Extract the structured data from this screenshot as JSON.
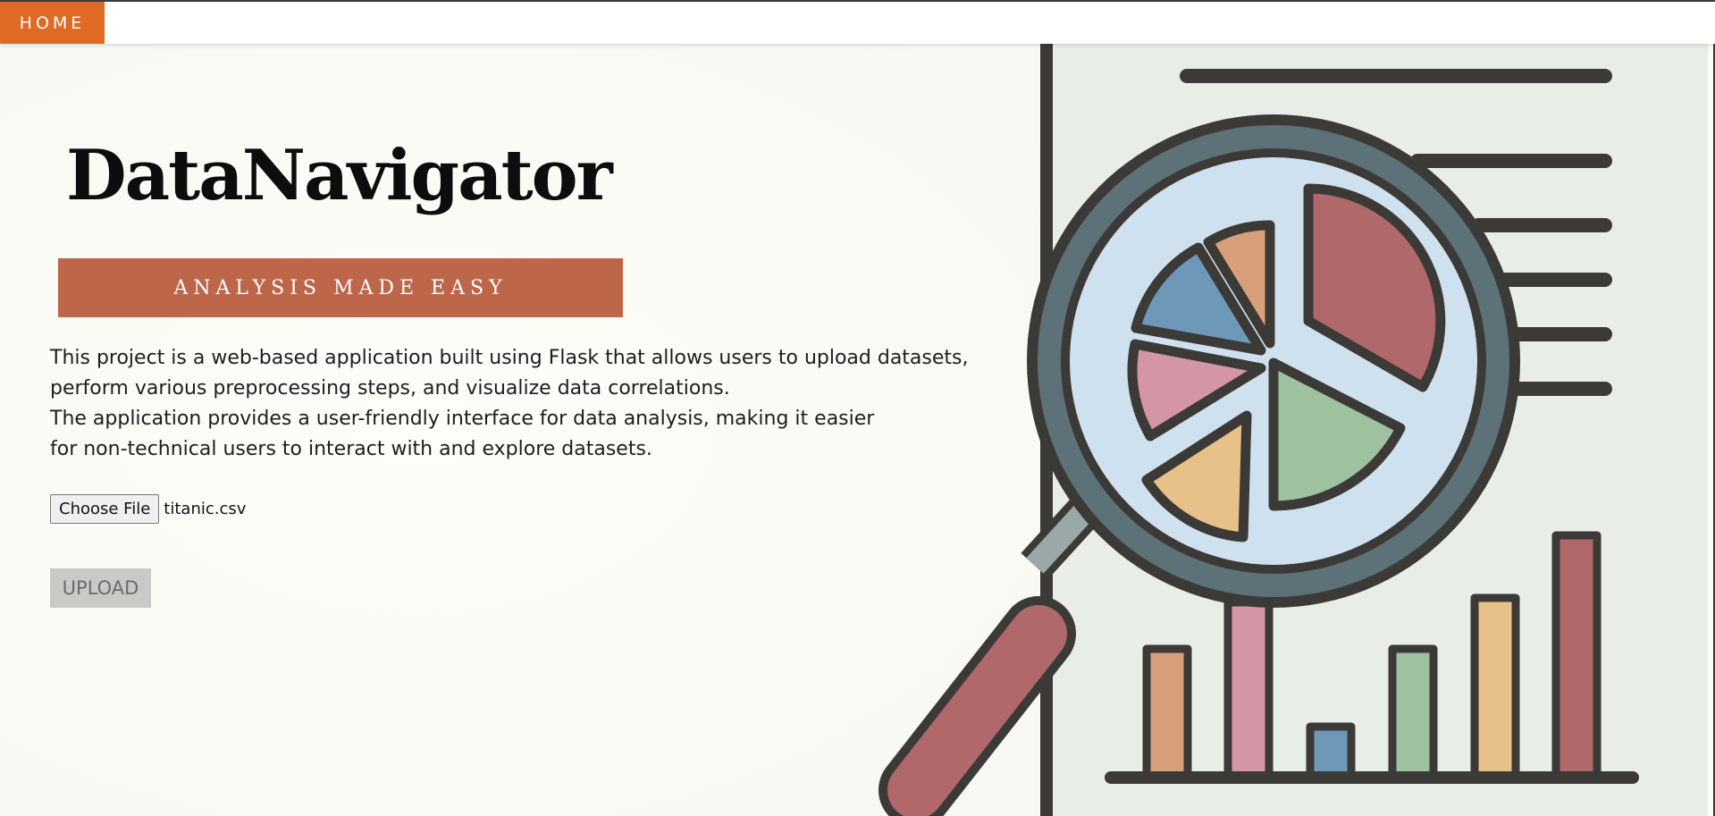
{
  "nav": {
    "home_label": "HOME"
  },
  "hero": {
    "title": "DataNavigator",
    "tagline": "ANALYSIS MADE EASY",
    "description_lines": [
      "This project is a web-based application built using Flask that allows users to upload datasets,",
      "perform various preprocessing steps, and visualize data correlations.",
      "The application provides a user-friendly interface for data analysis, making it easier",
      "for non-technical users to interact with and explore datasets."
    ]
  },
  "upload_form": {
    "choose_file_label": "Choose File",
    "selected_file": "titanic.csv",
    "upload_label": "UPLOAD",
    "upload_enabled": false
  },
  "illustration": {
    "icon": "magnifier-over-report-icon",
    "colors": {
      "accent_orange": "#de6a23",
      "tagline_bg": "#bd6649",
      "handle": "#b0686a",
      "outline": "#3b3a37"
    }
  }
}
